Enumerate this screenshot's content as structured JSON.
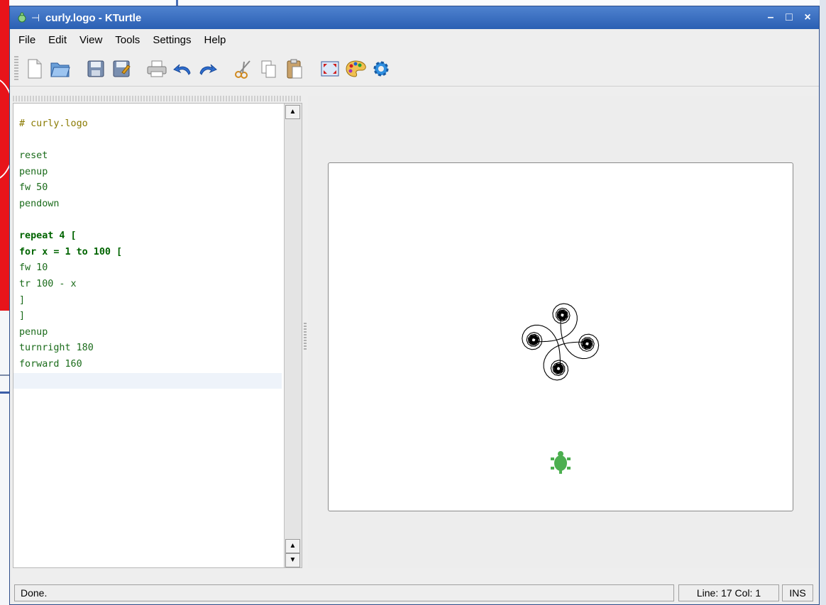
{
  "window": {
    "title": "curly.logo - KTurtle",
    "controls": {
      "minimize": "–",
      "maximize": "□",
      "close": "×"
    }
  },
  "menu": {
    "items": [
      {
        "label": "File"
      },
      {
        "label": "Edit"
      },
      {
        "label": "View"
      },
      {
        "label": "Tools"
      },
      {
        "label": "Settings"
      },
      {
        "label": "Help"
      }
    ]
  },
  "toolbar": {
    "icons": [
      "new-file-icon",
      "open-folder-icon",
      "save-icon",
      "save-as-icon",
      "print-icon",
      "undo-icon",
      "redo-icon",
      "cut-icon",
      "copy-icon",
      "paste-icon",
      "fullscreen-icon",
      "color-picker-icon",
      "settings-gear-icon"
    ]
  },
  "editor": {
    "lines": [
      "# curly.logo",
      "",
      "reset",
      "penup",
      "fw 50",
      "pendown",
      "",
      "repeat 4 [",
      "for x = 1 to 100 [",
      "fw 10",
      "tr 100 - x",
      "]",
      "]",
      "penup",
      "turnright 180",
      "forward 160"
    ]
  },
  "status": {
    "message": "Done.",
    "position": "Line: 17 Col: 1",
    "mode": "INS"
  },
  "colors": {
    "titlebar": "#2a5fb3",
    "turtle": "#4caf50",
    "comment": "#8a7a00",
    "number": "#1a36c9",
    "keyword": "#006400"
  }
}
